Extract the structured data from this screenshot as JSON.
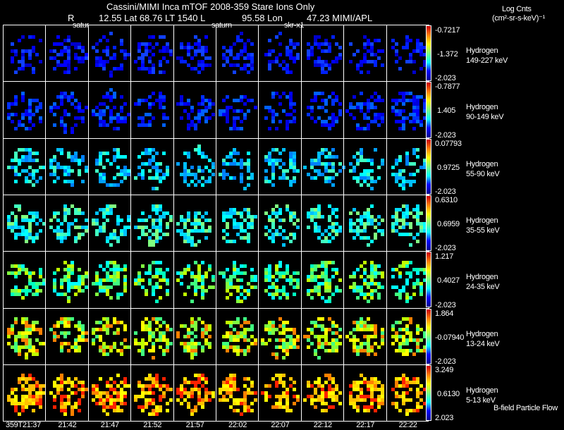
{
  "header": {
    "title": "Cassini/MIMI Inca mTOF  2008-359   Stare   Ions Only",
    "subtitle_r": "R",
    "subtitle_mid": "12.55 Lat 68.76 LT 1540 L",
    "subtitle_lon": "95.58 Lon",
    "subtitle_end": "47.23  MIMI/APL",
    "overlay_labels": [
      "satur",
      "saturn",
      "skr-x1"
    ]
  },
  "colorbar_title": {
    "line1": "Log Cnts",
    "line2": "(cm²-sr-s-keV)⁻¹"
  },
  "chart_data": {
    "type": "heatmap",
    "title": "Cassini/MIMI Inca mTOF  2008-359   Stare   Ions Only",
    "columns": [
      "359T21:37",
      "21:42",
      "21:47",
      "21:52",
      "21:57",
      "22:02",
      "22:07",
      "22:12",
      "22:17",
      "22:22"
    ],
    "rows": [
      {
        "species": "Hydrogen",
        "energy": "149-227 keV",
        "cmax": "-0.7217",
        "cmid": "-1.372",
        "cmin": "-2.023"
      },
      {
        "species": "Hydrogen",
        "energy": "90-149 keV",
        "cmax": "-0.7877",
        "cmid": "1.405",
        "cmin": "-2.023"
      },
      {
        "species": "Hydrogen",
        "energy": "55-90 keV",
        "cmax": "0.07793",
        "cmid": "0.9725",
        "cmin": "-2.023"
      },
      {
        "species": "Hydrogen",
        "energy": "35-55 keV",
        "cmax": "0.6310",
        "cmid": "0.6959",
        "cmin": "-2.023"
      },
      {
        "species": "Hydrogen",
        "energy": "24-35 keV",
        "cmax": "1.217",
        "cmid": "0.4027",
        "cmin": "-2.023"
      },
      {
        "species": "Hydrogen",
        "energy": "13-24 keV",
        "cmax": "1.864",
        "cmid": "-0.07940",
        "cmin": "-2.023"
      },
      {
        "species": "Hydrogen",
        "energy": "5-13 keV",
        "cmax": "3.249",
        "cmid": "0.6130",
        "cmin": "2.023"
      }
    ],
    "colormap": "rainbow (blue low, red high)"
  },
  "footer_note": "B-field Particle Flow"
}
